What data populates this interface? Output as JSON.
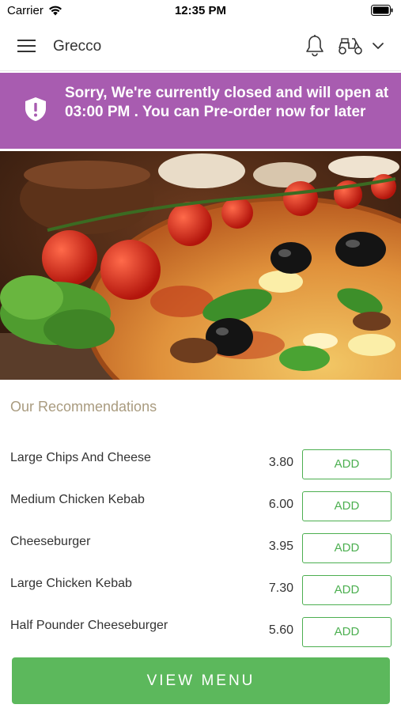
{
  "status_bar": {
    "carrier": "Carrier",
    "time": "12:35 PM"
  },
  "nav": {
    "title": "Grecco",
    "icons": [
      "menu-icon",
      "bell-icon",
      "scooter-icon",
      "chevron-down-icon"
    ]
  },
  "banner": {
    "message": "Sorry, We're currently closed and will open at 03:00 PM . You can Pre-order now for later",
    "color": "#a85cb0",
    "icon": "shield-alert-icon"
  },
  "recommendations": {
    "title": "Our Recommendations",
    "items": [
      {
        "name": "Large Chips And Cheese",
        "price": "3.80",
        "action": "ADD"
      },
      {
        "name": "Medium Chicken Kebab",
        "price": "6.00",
        "action": "ADD"
      },
      {
        "name": "Cheeseburger",
        "price": "3.95",
        "action": "ADD"
      },
      {
        "name": "Large Chicken Kebab",
        "price": "7.30",
        "action": "ADD"
      },
      {
        "name": "Half Pounder Cheeseburger",
        "price": "5.60",
        "action": "ADD"
      }
    ]
  },
  "footer": {
    "view_menu_label": "VIEW MENU",
    "accent": "#5cb85c"
  }
}
